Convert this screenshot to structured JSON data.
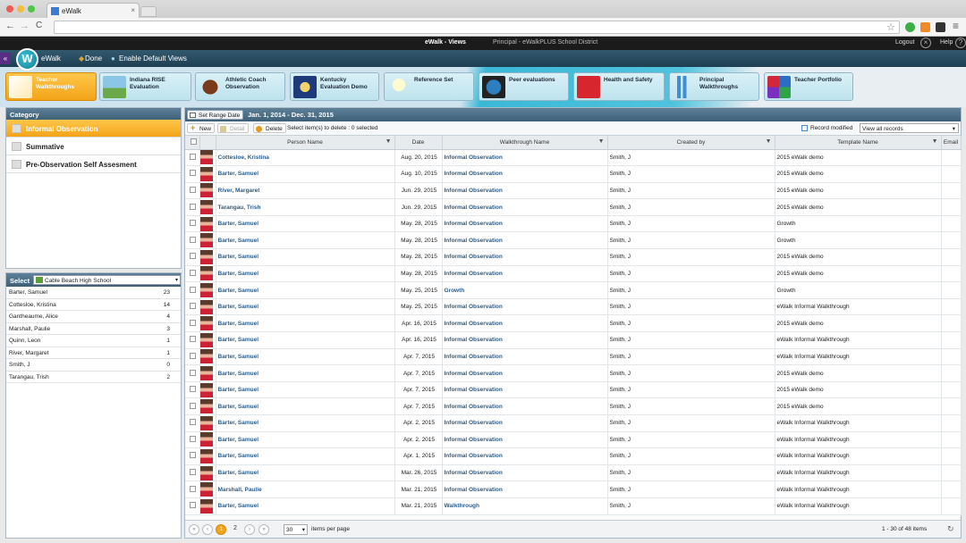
{
  "browser": {
    "tab_title": "eWalk",
    "close_glyph": "×",
    "back_glyph": "←",
    "forward_glyph": "→",
    "reload_glyph": "C",
    "star_glyph": "☆",
    "menu_glyph": "≡",
    "traffic_colors": [
      "#ee5b5b",
      "#f4be3c",
      "#4cc748"
    ]
  },
  "app_header": {
    "title": "eWalk - Views",
    "org": "Principal - eWalkPLUS School District",
    "logout": "Logout",
    "help": "Help"
  },
  "app_nav": {
    "back_glyph": "«",
    "logo_glyph": "W",
    "app_name": "eWalk",
    "done": "Done",
    "enable_default": "Enable Default Views"
  },
  "views": [
    {
      "label": "Teacher\nWalkthroughs",
      "icon": "chart-icon",
      "active": true
    },
    {
      "label": "Indiana RISE\nEvaluation",
      "icon": "landscape-icon",
      "active": false
    },
    {
      "label": "Athletic Coach\nObservation",
      "icon": "football-icon",
      "active": false
    },
    {
      "label": "Kentucky\nEvaluation Demo",
      "icon": "seal-icon",
      "active": false
    },
    {
      "label": "Reference Set",
      "icon": "lightbulb-icon",
      "active": false
    },
    {
      "label": "Peer evaluations",
      "icon": "gauge-icon",
      "active": false
    },
    {
      "label": "Health and Safety",
      "icon": "cross-icon",
      "active": false
    },
    {
      "label": "Principal\nWalkthroughs",
      "icon": "bars-icon",
      "active": false
    },
    {
      "label": "Teacher Portfolio",
      "icon": "squares-icon",
      "active": false
    }
  ],
  "category": {
    "heading": "Category",
    "items": [
      {
        "label": "Informal Observation",
        "selected": true
      },
      {
        "label": "Summative",
        "selected": false
      },
      {
        "label": "Pre-Observation Self Assesment",
        "selected": false
      }
    ]
  },
  "select_panel": {
    "heading": "Select",
    "school": "Cable Beach High School",
    "people": [
      {
        "name": "Barter, Samuel",
        "count": "23"
      },
      {
        "name": "Cottesloe, Kristina",
        "count": "14"
      },
      {
        "name": "Gantheaume, Alice",
        "count": "4"
      },
      {
        "name": "Marshall, Paulie",
        "count": "3"
      },
      {
        "name": "Quinn, Leon",
        "count": "1"
      },
      {
        "name": "River, Margaret",
        "count": "1"
      },
      {
        "name": "Smith, J",
        "count": "0"
      },
      {
        "name": "Tarangau, Trish",
        "count": "2"
      }
    ]
  },
  "grid": {
    "range_button": "Set Range Date",
    "range_text": "Jan. 1, 2014 - Dec. 31, 2015",
    "new": "New",
    "detail": "Detail",
    "delete": "Delete",
    "selection_status": "Select item(s) to delete : 0 selected",
    "record_modified": "Record modified",
    "view_filter": "View all records",
    "dropdown_glyph": "▾",
    "filter_glyph": "▼",
    "columns": [
      "Person Name",
      "Date",
      "Walkthrough Name",
      "Created by",
      "Template Name",
      "Email"
    ],
    "rows": [
      [
        "Cottesloe, Kristina",
        "Aug. 20, 2015",
        "Informal Observation",
        "Smith, J",
        "2015 eWalk demo",
        ""
      ],
      [
        "Barter, Samuel",
        "Aug. 10, 2015",
        "Informal Observation",
        "Smith, J",
        "2015 eWalk demo",
        ""
      ],
      [
        "River, Margaret",
        "Jun. 29, 2015",
        "Informal Observation",
        "Smith, J",
        "2015 eWalk demo",
        ""
      ],
      [
        "Tarangau, Trish",
        "Jun. 29, 2015",
        "Informal Observation",
        "Smith, J",
        "2015 eWalk demo",
        ""
      ],
      [
        "Barter, Samuel",
        "May. 28, 2015",
        "Informal Observation",
        "Smith, J",
        "Growth",
        ""
      ],
      [
        "Barter, Samuel",
        "May. 28, 2015",
        "Informal Observation",
        "Smith, J",
        "Growth",
        ""
      ],
      [
        "Barter, Samuel",
        "May. 28, 2015",
        "Informal Observation",
        "Smith, J",
        "2015 eWalk demo",
        ""
      ],
      [
        "Barter, Samuel",
        "May. 28, 2015",
        "Informal Observation",
        "Smith, J",
        "2015 eWalk demo",
        ""
      ],
      [
        "Barter, Samuel",
        "May. 25, 2015",
        "Growth",
        "Smith, J",
        "Growth",
        ""
      ],
      [
        "Barter, Samuel",
        "May. 25, 2015",
        "Informal Observation",
        "Smith, J",
        "eWalk Informal Walkthrough",
        ""
      ],
      [
        "Barter, Samuel",
        "Apr. 16, 2015",
        "Informal Observation",
        "Smith, J",
        "2015 eWalk demo",
        ""
      ],
      [
        "Barter, Samuel",
        "Apr. 16, 2015",
        "Informal Observation",
        "Smith, J",
        "eWalk Informal Walkthrough",
        ""
      ],
      [
        "Barter, Samuel",
        "Apr. 7, 2015",
        "Informal Observation",
        "Smith, J",
        "eWalk Informal Walkthrough",
        ""
      ],
      [
        "Barter, Samuel",
        "Apr. 7, 2015",
        "Informal Observation",
        "Smith, J",
        "2015 eWalk demo",
        ""
      ],
      [
        "Barter, Samuel",
        "Apr. 7, 2015",
        "Informal Observation",
        "Smith, J",
        "2015 eWalk demo",
        ""
      ],
      [
        "Barter, Samuel",
        "Apr. 7, 2015",
        "Informal Observation",
        "Smith, J",
        "2015 eWalk demo",
        ""
      ],
      [
        "Barter, Samuel",
        "Apr. 2, 2015",
        "Informal Observation",
        "Smith, J",
        "eWalk Informal Walkthrough",
        ""
      ],
      [
        "Barter, Samuel",
        "Apr. 2, 2015",
        "Informal Observation",
        "Smith, J",
        "eWalk Informal Walkthrough",
        ""
      ],
      [
        "Barter, Samuel",
        "Apr. 1, 2015",
        "Informal Observation",
        "Smith, J",
        "eWalk Informal Walkthrough",
        ""
      ],
      [
        "Barter, Samuel",
        "Mar. 26, 2015",
        "Informal Observation",
        "Smith, J",
        "eWalk Informal Walkthrough",
        ""
      ],
      [
        "Marshall, Paulie",
        "Mar. 21, 2015",
        "Informal Observation",
        "Smith, J",
        "eWalk Informal Walkthrough",
        ""
      ],
      [
        "Barter, Samuel",
        "Mar. 21, 2015",
        "Walkthrough",
        "Smith, J",
        "eWalk Informal Walkthrough",
        ""
      ]
    ]
  },
  "pager": {
    "first": "«",
    "prev": "‹",
    "current": "1",
    "page2": "2",
    "next": "›",
    "last": "»",
    "per_page": "30",
    "per_page_label": "items per page",
    "summary": "1 - 30 of 48 items",
    "refresh_glyph": "↻"
  },
  "colors": {
    "accent": "#f3a418",
    "header_blue": "#3e6077",
    "link": "#2b5d8b"
  }
}
